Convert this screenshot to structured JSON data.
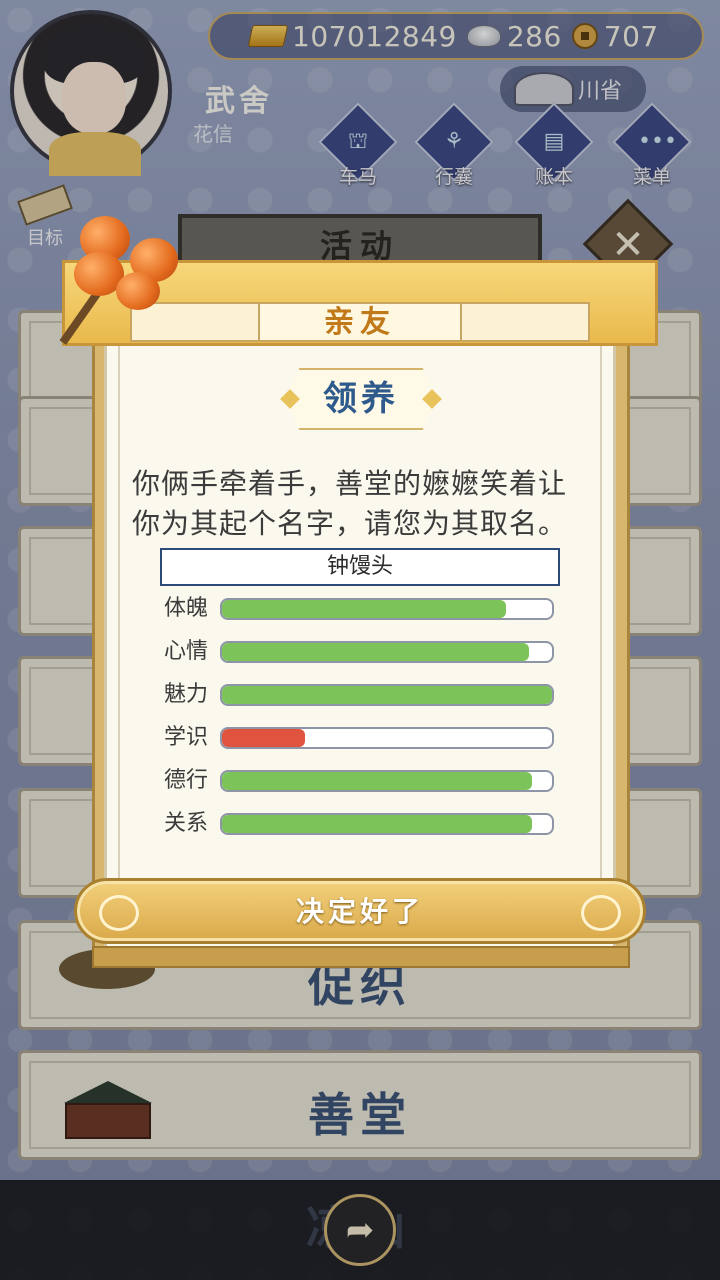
{
  "currency": {
    "gold": "107012849",
    "silver": "286",
    "coins": "707"
  },
  "player": {
    "name": "武舍",
    "subtitle": "花信"
  },
  "region": {
    "label": "川省"
  },
  "nav": [
    {
      "label": "车马",
      "glyph": "⛫"
    },
    {
      "label": "行囊",
      "glyph": "⚘"
    },
    {
      "label": "账本",
      "glyph": "▤"
    },
    {
      "label": "菜单",
      "glyph": "•••"
    }
  ],
  "goal": {
    "label": "目标"
  },
  "activity": {
    "title": "活动"
  },
  "background_cards": [
    "促织",
    "善堂",
    "凉山"
  ],
  "dialog": {
    "header": "亲友",
    "section": "领养",
    "message": "你俩手牵着手，善堂的嬷嬷笑着让你为其起个名字，请您为其取名。",
    "name_value": "钟馒头",
    "confirm": "决定好了",
    "stats": [
      {
        "label": "体魄",
        "value": 0.86,
        "color": "#7cc35a"
      },
      {
        "label": "心情",
        "value": 0.93,
        "color": "#7cc35a"
      },
      {
        "label": "魅力",
        "value": 1.0,
        "color": "#7cc35a"
      },
      {
        "label": "学识",
        "value": 0.25,
        "color": "#e0533f"
      },
      {
        "label": "德行",
        "value": 0.94,
        "color": "#7cc35a"
      },
      {
        "label": "关系",
        "value": 0.94,
        "color": "#7cc35a"
      }
    ]
  }
}
